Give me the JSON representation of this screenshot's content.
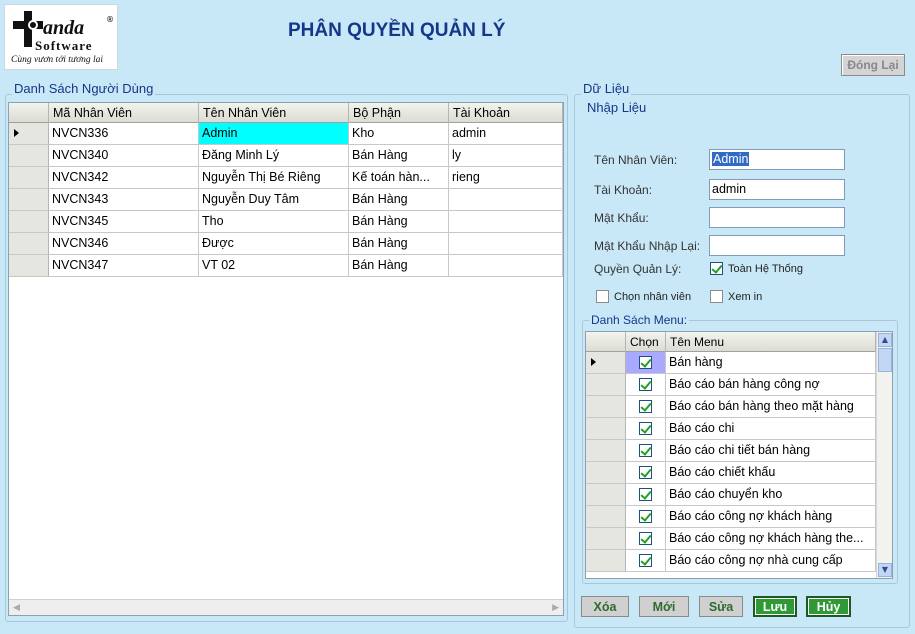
{
  "logo": {
    "brand": "anda",
    "sub": "Software",
    "slogan": "Cùng vươn tới tương lai",
    "reg": "®"
  },
  "page_title": "PHÂN QUYỀN QUẢN LÝ",
  "close_button": "Đóng Lại",
  "user_list": {
    "title": "Danh Sách Người Dùng",
    "columns": [
      "Mã Nhân Viên",
      "Tên Nhân Viên",
      "Bộ Phận",
      "Tài Khoản"
    ],
    "rows": [
      [
        "NVCN336",
        "Admin",
        "Kho",
        "admin"
      ],
      [
        "NVCN340",
        "Đăng Minh Lý",
        "Bán Hàng",
        "ly"
      ],
      [
        "NVCN342",
        "Nguyễn Thị Bé Riêng",
        "Kế toán hàn...",
        "rieng"
      ],
      [
        "NVCN343",
        "Nguyễn Duy Tâm",
        "Bán Hàng",
        ""
      ],
      [
        "NVCN345",
        "Tho",
        "Bán Hàng",
        ""
      ],
      [
        "NVCN346",
        "Được",
        "Bán Hàng",
        ""
      ],
      [
        "NVCN347",
        "VT 02",
        "Bán Hàng",
        ""
      ]
    ]
  },
  "data_section": {
    "title": "Dữ Liệu",
    "input_title": "Nhập Liệu",
    "employee_name_label": "Tên Nhân Viên:",
    "employee_name_value": "Admin",
    "account_label": "Tài Khoản:",
    "account_value": "admin",
    "password_label": "Mật Khẩu:",
    "password_value": "",
    "password_confirm_label": "Mật Khẩu Nhập Lại:",
    "password_confirm_value": "",
    "role_label": "Quyền Quản Lý:",
    "full_system_label": "Toàn Hệ Thống",
    "select_employee_label": "Chọn nhân viên",
    "view_in_label": "Xem in"
  },
  "menu_list": {
    "title": "Danh Sách Menu:",
    "columns": [
      "Chọn",
      "Tên Menu"
    ],
    "rows": [
      {
        "checked": true,
        "name": "Bán hàng"
      },
      {
        "checked": true,
        "name": "Báo cáo bán hàng công nợ"
      },
      {
        "checked": true,
        "name": "Báo cáo bán hàng theo mặt hàng"
      },
      {
        "checked": true,
        "name": "Báo cáo chi"
      },
      {
        "checked": true,
        "name": "Báo cáo chi tiết bán hàng"
      },
      {
        "checked": true,
        "name": "Báo cáo chiết khấu"
      },
      {
        "checked": true,
        "name": "Báo cáo chuyển kho"
      },
      {
        "checked": true,
        "name": "Báo cáo công nợ khách hàng"
      },
      {
        "checked": true,
        "name": "Báo cáo công nợ khách hàng the..."
      },
      {
        "checked": true,
        "name": "Báo cáo công nợ nhà cung cấp"
      }
    ]
  },
  "actions": {
    "delete": "Xóa",
    "new": "Mới",
    "edit": "Sửa",
    "save": "Lưu",
    "cancel": "Hủy"
  }
}
